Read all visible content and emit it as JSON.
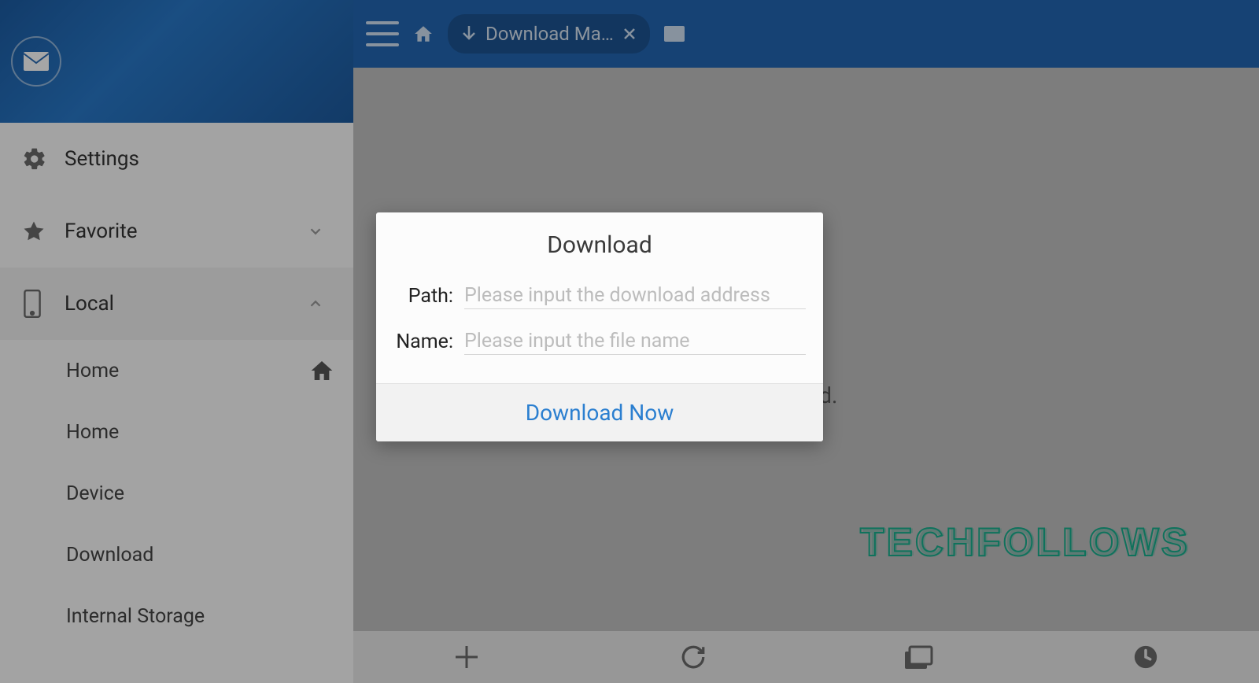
{
  "sidebar": {
    "items": [
      {
        "label": "Settings"
      },
      {
        "label": "Favorite"
      },
      {
        "label": "Local"
      }
    ],
    "subitems": [
      {
        "label": "Home"
      },
      {
        "label": "Home"
      },
      {
        "label": "Device"
      },
      {
        "label": "Download"
      },
      {
        "label": "Internal Storage"
      }
    ]
  },
  "topbar": {
    "tab_label": "Download Ma…"
  },
  "content": {
    "empty_message": "found."
  },
  "modal": {
    "title": "Download",
    "path_label": "Path:",
    "path_placeholder": "Please input the download address",
    "name_label": "Name:",
    "name_placeholder": "Please input the file name",
    "action_label": "Download Now"
  },
  "watermark": "TECHFOLLOWS"
}
